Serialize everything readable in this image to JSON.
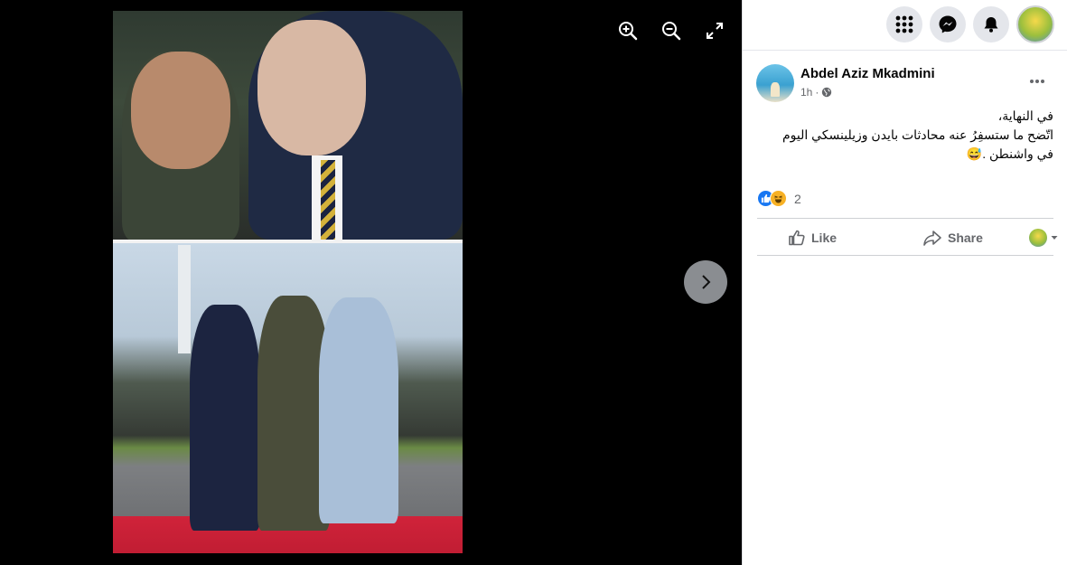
{
  "viewer": {
    "tools": [
      {
        "name": "zoom-in-icon",
        "icon": "zoom-in"
      },
      {
        "name": "zoom-out-icon",
        "icon": "zoom-out"
      },
      {
        "name": "fullscreen-icon",
        "icon": "expand"
      }
    ],
    "next_icon": "chevron-right"
  },
  "topbar": {
    "buttons": [
      "menu-grid",
      "messenger",
      "notifications",
      "profile"
    ]
  },
  "post": {
    "author": "Abdel Aziz Mkadmini",
    "time": "1h",
    "audience_icon": "globe",
    "text_lines": [
      "في النهاية،",
      "اتّضح ما ستسفِرُ عنه محادثات بايدن وزيلينسكي اليوم",
      "في واشنطن .😅"
    ],
    "reaction_count": "2",
    "reactions": [
      "like",
      "haha"
    ],
    "actions": {
      "like": "Like",
      "share": "Share"
    }
  },
  "colors": {
    "viewer_bg": "#000000",
    "icon_gray": "#65676b",
    "like_blue": "#1877f2",
    "haha_yellow": "#f7b125"
  }
}
